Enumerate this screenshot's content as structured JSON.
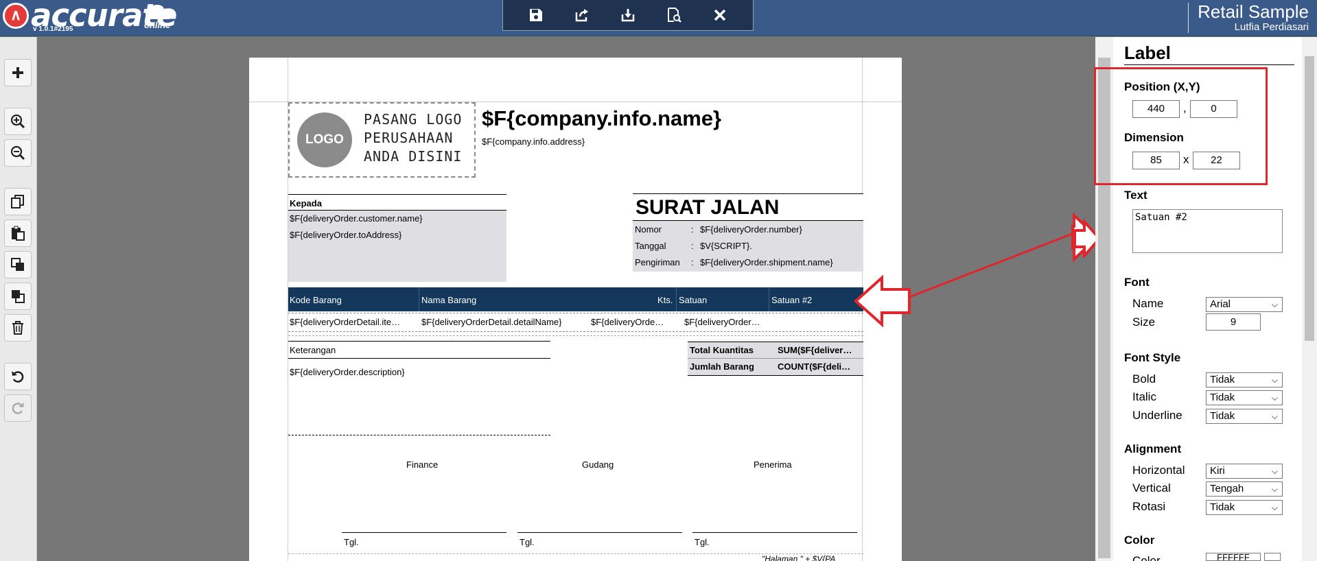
{
  "header": {
    "brand": "accurate",
    "brand_sub": "online",
    "version": "v 1.0.1#2195",
    "company": "Retail Sample",
    "user": "Lutfia Perdiasari"
  },
  "top_toolbar": [
    "save-icon",
    "export-icon",
    "import-icon",
    "preview-icon",
    "close-icon"
  ],
  "left_toolbar": [
    "add-icon",
    "zoom-in-icon",
    "zoom-out-icon",
    "copy-icon",
    "paste-icon",
    "bring-front-icon",
    "send-back-icon",
    "delete-icon",
    "undo-icon",
    "redo-icon"
  ],
  "document": {
    "logo_badge": "LOGO",
    "logo_text": [
      "PASANG LOGO",
      "PERUSAHAAN",
      "ANDA DISINI"
    ],
    "company_name": "$F{company.info.name}",
    "company_address": "$F{company.info.address}",
    "to_label": "Kepada",
    "customer_name": "$F{deliveryOrder.customer.name}",
    "to_address": "$F{deliveryOrder.toAddress}",
    "title": "SURAT JALAN",
    "info_rows": [
      {
        "label": "Nomor",
        "sep": ":",
        "value": "$F{deliveryOrder.number}"
      },
      {
        "label": "Tanggal",
        "sep": ":",
        "value": "$V{SCRIPT}."
      },
      {
        "label": "Pengiriman",
        "sep": ":",
        "value": "$F{deliveryOrder.shipment.name}"
      }
    ],
    "columns": [
      "Kode Barang",
      "Nama Barang",
      "Kts.",
      "Satuan",
      "Satuan #2"
    ],
    "row": [
      "$F{deliveryOrderDetail.ite…",
      "$F{deliveryOrderDetail.detailName}",
      "$F{deliveryOrde…",
      "$F{deliveryOrder…"
    ],
    "note_label": "Keterangan",
    "note_value": "$F{deliveryOrder.description}",
    "totals": [
      {
        "label": "Total Kuantitas",
        "value": "SUM($F{deliver…"
      },
      {
        "label": "Jumlah Barang",
        "value": "COUNT($F{deli…"
      }
    ],
    "signatures": [
      "Finance",
      "Gudang",
      "Penerima"
    ],
    "tgl": "Tgl.",
    "footer": "\"Halaman \" + $V{PA"
  },
  "panel": {
    "title": "Label",
    "position_label": "Position (X,Y)",
    "pos_x": "440",
    "pos_sep": ",",
    "pos_y": "0",
    "dimension_label": "Dimension",
    "dim_w": "85",
    "dim_sep": "x",
    "dim_h": "22",
    "text_label": "Text",
    "text_value": "Satuan #2",
    "font_label": "Font",
    "name_label": "Name",
    "name_value": "Arial",
    "size_label": "Size",
    "size_value": "9",
    "font_style_label": "Font Style",
    "bold_label": "Bold",
    "bold_value": "Tidak",
    "italic_label": "Italic",
    "italic_value": "Tidak",
    "underline_label": "Underline",
    "underline_value": "Tidak",
    "alignment_label": "Alignment",
    "horizontal_label": "Horizontal",
    "horizontal_value": "Kiri",
    "vertical_label": "Vertical",
    "vertical_value": "Tengah",
    "rotasi_label": "Rotasi",
    "rotasi_value": "Tidak",
    "color_label": "Color",
    "color_sub_label": "Color",
    "color_value": "FFFFFF"
  },
  "colors": {
    "header": "#3a5a8a",
    "grid_header": "#14385c",
    "highlight": "#e0262c"
  }
}
